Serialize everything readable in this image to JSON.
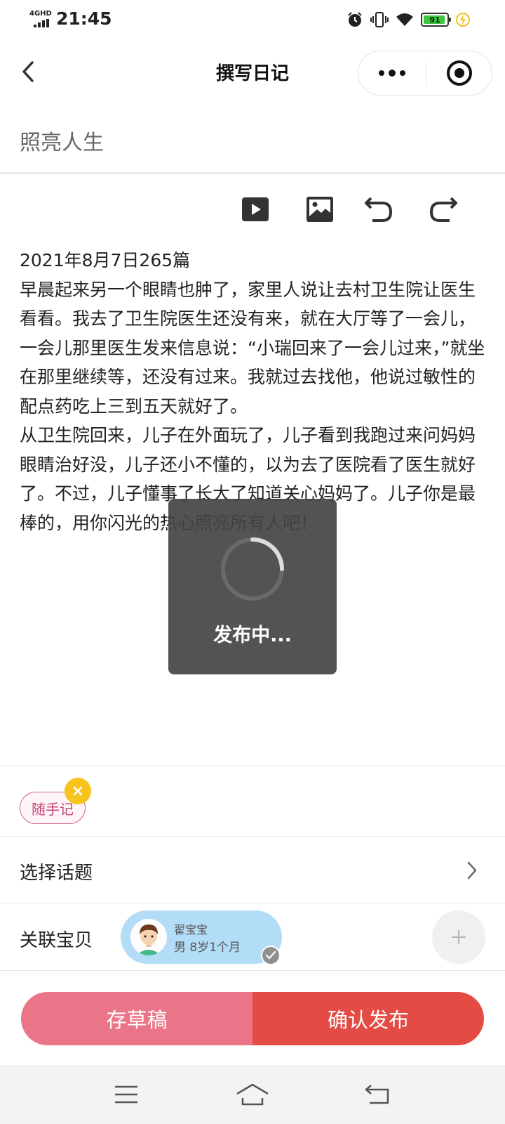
{
  "status_bar": {
    "network": "4GHD",
    "time": "21:45",
    "battery": "91",
    "icons": [
      "signal-icon",
      "alarm-icon",
      "vibrate-icon",
      "wifi-icon",
      "battery-icon",
      "charging-icon"
    ]
  },
  "nav": {
    "title": "撰写日记",
    "icons": [
      "back-icon",
      "more-icon",
      "close-miniprogram-icon"
    ]
  },
  "editor": {
    "title_value": "照亮人生",
    "toolbar_icons": [
      "video-icon",
      "image-icon",
      "undo-icon",
      "redo-icon"
    ],
    "content": [
      "2021年8月7日265篇",
      "早晨起来另一个眼睛也肿了，家里人说让去村卫生院让医生看看。我去了卫生院医生还没有来，就在大厅等了一会儿，一会儿那里医生发来信息说：“小瑞回来了一会儿过来，”就坐在那里继续等，还没有过来。我就过去找他，他说过敏性的配点药吃上三到五天就好了。",
      "从卫生院回来，儿子在外面玩了，儿子看到我跑过来问妈妈眼睛治好没，儿子还小不懂的，以为去了医院看了医生就好了。不过，儿子懂事了长大了知道关心妈妈了。儿子你是最棒的，用你闪光的热心照亮所有人吧！"
    ]
  },
  "loading": {
    "text": "发布中..."
  },
  "tag": {
    "label": "随手记"
  },
  "topic": {
    "label": "选择话题"
  },
  "baby": {
    "label": "关联宝贝",
    "name": "翟宝宝",
    "info": "男  8岁1个月"
  },
  "actions": {
    "draft": "存草稿",
    "publish": "确认发布"
  },
  "colors": {
    "draft_button": "#ea7588",
    "publish_button": "#e44b45",
    "tag_border": "#d06a8e",
    "tag_remove": "#f7c31e",
    "baby_card": "#b3dcf7",
    "toast_bg": "#444444"
  }
}
